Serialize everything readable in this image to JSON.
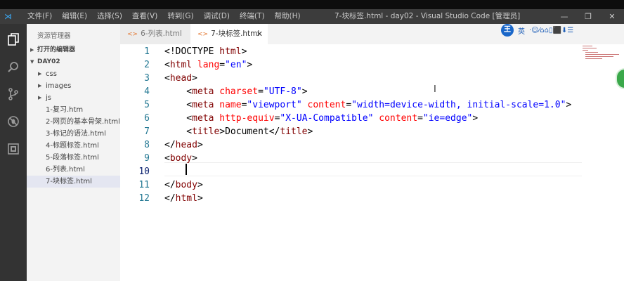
{
  "menu": [
    "文件(F)",
    "编辑(E)",
    "选择(S)",
    "查看(V)",
    "转到(G)",
    "调试(D)",
    "终端(T)",
    "帮助(H)"
  ],
  "window_title": "7-块标签.html - day02 - Visual Studio Code [管理员]",
  "window_controls": {
    "minimize": "—",
    "maximize": "❐",
    "close": "✕"
  },
  "sidebar": {
    "title": "资源管理器",
    "open_editors_label": "打开的编辑器",
    "folder_label": "DAY02",
    "items": [
      {
        "label": "css",
        "folder": true
      },
      {
        "label": "images",
        "folder": true
      },
      {
        "label": "js",
        "folder": true
      },
      {
        "label": "1-复习.htm",
        "folder": false
      },
      {
        "label": "2-网页的基本骨架.html",
        "folder": false
      },
      {
        "label": "3-标记的语法.html",
        "folder": false
      },
      {
        "label": "4-标题标签.html",
        "folder": false
      },
      {
        "label": "5-段落标签.html",
        "folder": false
      },
      {
        "label": "6-列表.html",
        "folder": false
      },
      {
        "label": "7-块标签.html",
        "folder": false,
        "selected": true
      }
    ]
  },
  "tabs": [
    {
      "label": "6-列表.html",
      "active": false
    },
    {
      "label": "7-块标签.html",
      "active": true
    }
  ],
  "tray": {
    "w": "王",
    "lang": "英",
    "extra": "·☺⁄⌂⌂▯⬛⬇☰"
  },
  "editor": {
    "line_numbers": [
      "1",
      "2",
      "3",
      "4",
      "5",
      "6",
      "7",
      "8",
      "9",
      "10",
      "11",
      "12"
    ],
    "current_line": 10,
    "lines": [
      [
        {
          "c": "p",
          "t": "<!DOCTYPE "
        },
        {
          "c": "t",
          "t": "html"
        },
        {
          "c": "p",
          "t": ">"
        }
      ],
      [
        {
          "c": "p",
          "t": "<"
        },
        {
          "c": "t",
          "t": "html"
        },
        {
          "c": "p",
          "t": " "
        },
        {
          "c": "a",
          "t": "lang"
        },
        {
          "c": "p",
          "t": "="
        },
        {
          "c": "v",
          "t": "\"en\""
        },
        {
          "c": "p",
          "t": ">"
        }
      ],
      [
        {
          "c": "p",
          "t": "<"
        },
        {
          "c": "t",
          "t": "head"
        },
        {
          "c": "p",
          "t": ">"
        }
      ],
      [
        {
          "c": "p",
          "t": "    <"
        },
        {
          "c": "t",
          "t": "meta"
        },
        {
          "c": "p",
          "t": " "
        },
        {
          "c": "a",
          "t": "charset"
        },
        {
          "c": "p",
          "t": "="
        },
        {
          "c": "v",
          "t": "\"UTF-8\""
        },
        {
          "c": "p",
          "t": ">"
        }
      ],
      [
        {
          "c": "p",
          "t": "    <"
        },
        {
          "c": "t",
          "t": "meta"
        },
        {
          "c": "p",
          "t": " "
        },
        {
          "c": "a",
          "t": "name"
        },
        {
          "c": "p",
          "t": "="
        },
        {
          "c": "v",
          "t": "\"viewport\""
        },
        {
          "c": "p",
          "t": " "
        },
        {
          "c": "a",
          "t": "content"
        },
        {
          "c": "p",
          "t": "="
        },
        {
          "c": "v",
          "t": "\"width=device-width, initial-scale=1.0\""
        },
        {
          "c": "p",
          "t": ">"
        }
      ],
      [
        {
          "c": "p",
          "t": "    <"
        },
        {
          "c": "t",
          "t": "meta"
        },
        {
          "c": "p",
          "t": " "
        },
        {
          "c": "a",
          "t": "http-equiv"
        },
        {
          "c": "p",
          "t": "="
        },
        {
          "c": "v",
          "t": "\"X-UA-Compatible\""
        },
        {
          "c": "p",
          "t": " "
        },
        {
          "c": "a",
          "t": "content"
        },
        {
          "c": "p",
          "t": "="
        },
        {
          "c": "v",
          "t": "\"ie=edge\""
        },
        {
          "c": "p",
          "t": ">"
        }
      ],
      [
        {
          "c": "p",
          "t": "    <"
        },
        {
          "c": "t",
          "t": "title"
        },
        {
          "c": "p",
          "t": ">Document</"
        },
        {
          "c": "t",
          "t": "title"
        },
        {
          "c": "p",
          "t": ">"
        }
      ],
      [
        {
          "c": "p",
          "t": "</"
        },
        {
          "c": "t",
          "t": "head"
        },
        {
          "c": "p",
          "t": ">"
        }
      ],
      [
        {
          "c": "p",
          "t": "<"
        },
        {
          "c": "t",
          "t": "body"
        },
        {
          "c": "p",
          "t": ">"
        }
      ],
      [
        {
          "c": "p",
          "t": "    "
        }
      ],
      [
        {
          "c": "p",
          "t": "</"
        },
        {
          "c": "t",
          "t": "body"
        },
        {
          "c": "p",
          "t": ">"
        }
      ],
      [
        {
          "c": "p",
          "t": "</"
        },
        {
          "c": "t",
          "t": "html"
        },
        {
          "c": "p",
          "t": ">"
        }
      ]
    ]
  },
  "colors": {
    "tag": "#800000",
    "attribute": "#ff0000",
    "value": "#0000ff",
    "line_number": "#237893"
  }
}
